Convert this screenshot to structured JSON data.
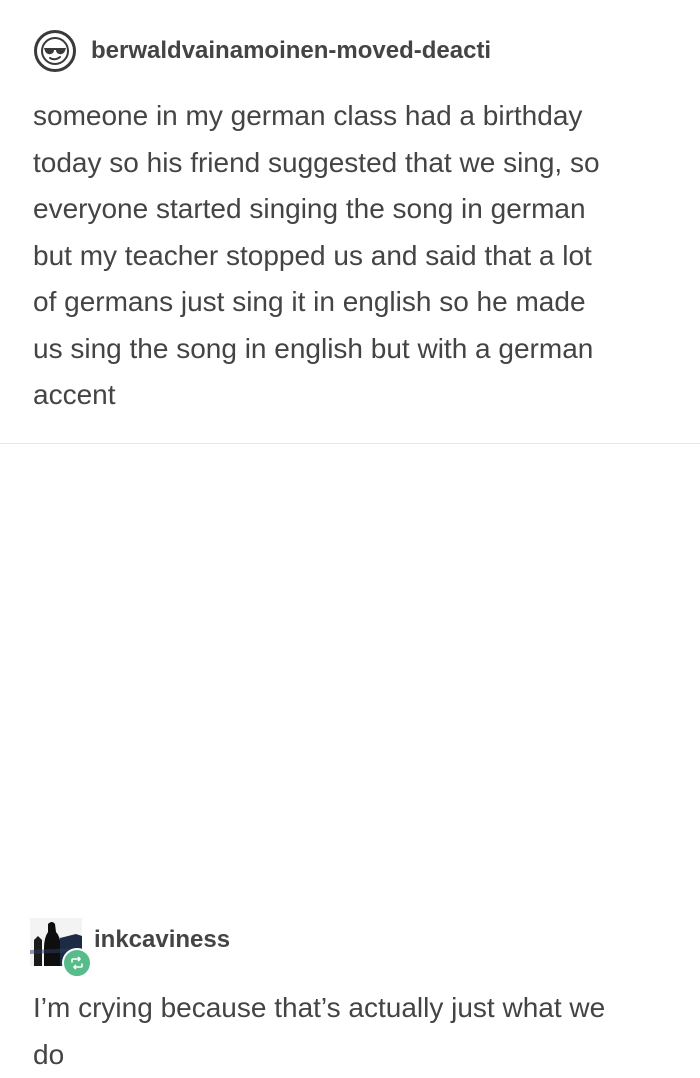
{
  "posts": [
    {
      "username": "berwaldvainamoinen-moved-deacti",
      "avatar_icon": "sunglasses-face-icon",
      "text": "someone in my german class had a birthday\ntoday so his friend suggested that we sing, so\neveryone started singing the song in german\nbut my teacher stopped us and said that a lot\nof germans just sing it in english so he made\nus sing the song in english but with a german\naccent"
    },
    {
      "username": "inkcaviness",
      "avatar_icon": "silhouette-avatar-icon",
      "badge_icon": "reblog-icon",
      "badge_color": "#56bc8a",
      "text": "I’m crying because that’s actually just what we\ndo"
    }
  ]
}
